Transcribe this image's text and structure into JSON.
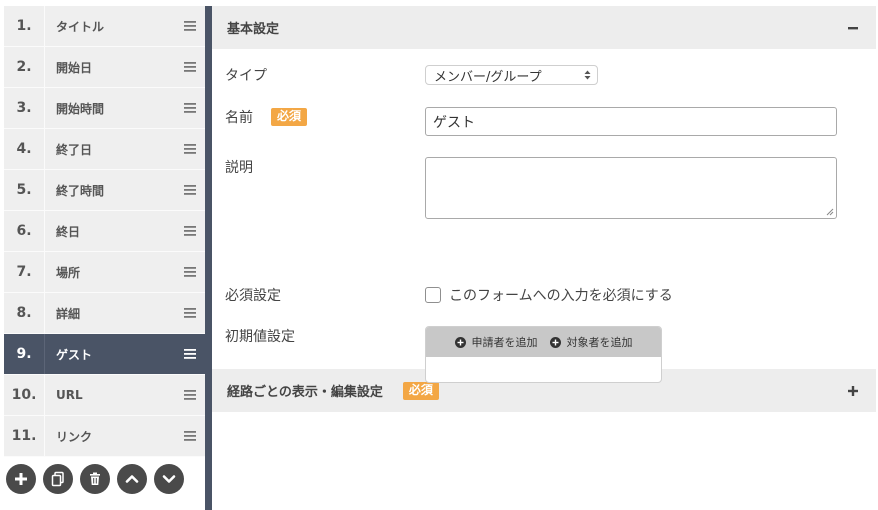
{
  "sidebar": {
    "items": [
      {
        "num": "1.",
        "label": "タイトル",
        "active": false
      },
      {
        "num": "2.",
        "label": "開始日",
        "active": false
      },
      {
        "num": "3.",
        "label": "開始時間",
        "active": false
      },
      {
        "num": "4.",
        "label": "終了日",
        "active": false
      },
      {
        "num": "5.",
        "label": "終了時間",
        "active": false
      },
      {
        "num": "6.",
        "label": "終日",
        "active": false
      },
      {
        "num": "7.",
        "label": "場所",
        "active": false
      },
      {
        "num": "8.",
        "label": "詳細",
        "active": false
      },
      {
        "num": "9.",
        "label": "ゲスト",
        "active": true
      },
      {
        "num": "10.",
        "label": "URL",
        "active": false
      },
      {
        "num": "11.",
        "label": "リンク",
        "active": false
      }
    ],
    "toolbar_icons": [
      "plus-icon",
      "copy-icon",
      "trash-icon",
      "chevron-up-icon",
      "chevron-down-icon"
    ]
  },
  "basic": {
    "title": "基本設定",
    "type_label": "タイプ",
    "type_value": "メンバー/グループ",
    "name_label": "名前",
    "required_badge": "必須",
    "name_value": "ゲスト",
    "desc_label": "説明",
    "required_setting_label": "必須設定",
    "required_checkbox_label": "このフォームへの入力を必須にする",
    "initial_label": "初期値設定",
    "add_applicant": "申請者を追加",
    "add_target": "対象者を追加"
  },
  "route": {
    "title": "経路ごとの表示・編集設定",
    "required_badge": "必須"
  },
  "colors": {
    "active_bg": "#4a5466",
    "badge": "#f3a745"
  }
}
